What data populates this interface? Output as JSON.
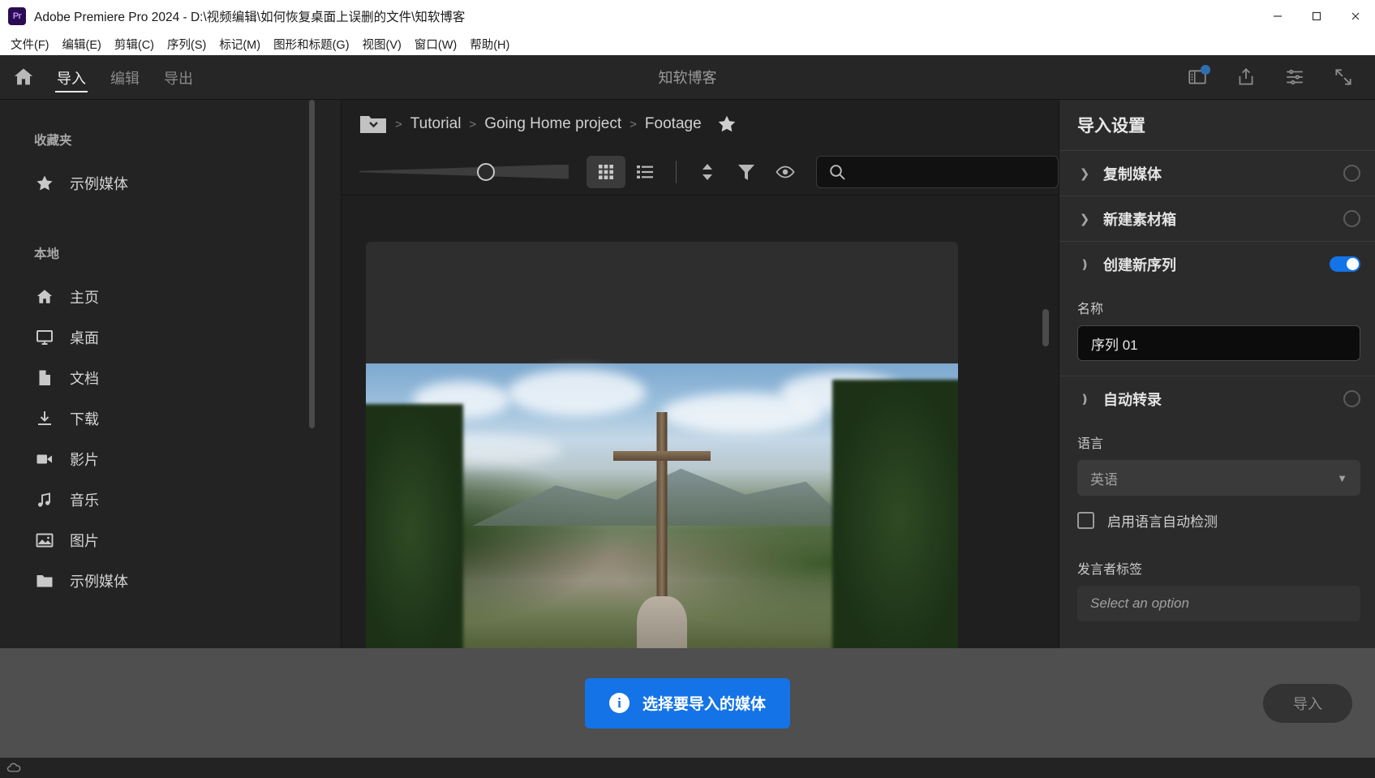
{
  "window": {
    "app_badge": "Pr",
    "title": "Adobe Premiere Pro 2024 - D:\\视频编辑\\如何恢复桌面上误删的文件\\知软博客",
    "minimize_icon": "minimize-icon",
    "maximize_icon": "maximize-icon",
    "close_icon": "close-icon"
  },
  "menubar": {
    "items": [
      {
        "label": "文件(F)"
      },
      {
        "label": "编辑(E)"
      },
      {
        "label": "剪辑(C)"
      },
      {
        "label": "序列(S)"
      },
      {
        "label": "标记(M)"
      },
      {
        "label": "图形和标题(G)"
      },
      {
        "label": "视图(V)"
      },
      {
        "label": "窗口(W)"
      },
      {
        "label": "帮助(H)"
      }
    ]
  },
  "navbar": {
    "home_icon": "home-icon",
    "tabs": [
      {
        "label": "导入",
        "active": true
      },
      {
        "label": "编辑",
        "active": false
      },
      {
        "label": "导出",
        "active": false
      }
    ],
    "center_title": "知软博客",
    "right_icons": [
      {
        "name": "workspace-notification-icon"
      },
      {
        "name": "share-icon"
      },
      {
        "name": "settings-lines-icon"
      },
      {
        "name": "fullscreen-icon"
      }
    ],
    "badge_color": "#2f6fb0"
  },
  "sidebar": {
    "favorites_heading": "收藏夹",
    "favorites": [
      {
        "label": "示例媒体",
        "icon": "star-icon"
      }
    ],
    "local_heading": "本地",
    "local": [
      {
        "label": "主页",
        "icon": "home-icon"
      },
      {
        "label": "桌面",
        "icon": "monitor-icon"
      },
      {
        "label": "文档",
        "icon": "document-icon"
      },
      {
        "label": "下载",
        "icon": "download-icon"
      },
      {
        "label": "影片",
        "icon": "video-camera-icon"
      },
      {
        "label": "音乐",
        "icon": "music-note-icon"
      },
      {
        "label": "图片",
        "icon": "image-icon"
      },
      {
        "label": "示例媒体",
        "icon": "folder-icon"
      }
    ]
  },
  "browser": {
    "breadcrumb": {
      "folder_icon": "folder-dropdown-icon",
      "items": [
        "Tutorial",
        "Going Home project",
        "Footage"
      ],
      "separator": ">",
      "favorite_icon": "star-icon"
    },
    "toolbar": {
      "zoom_slider_value": 56,
      "grid_view_icon": "grid-view-icon",
      "list_view_icon": "list-view-icon",
      "sort_icon": "sort-arrows-icon",
      "filter_icon": "filter-funnel-icon",
      "preview_icon": "eye-icon",
      "search_icon": "search-icon",
      "search_value": "",
      "search_placeholder": ""
    }
  },
  "import_settings": {
    "title": "导入设置",
    "sections": [
      {
        "label": "复制媒体",
        "expanded": false,
        "control": "knob"
      },
      {
        "label": "新建素材箱",
        "expanded": false,
        "control": "knob"
      },
      {
        "label": "创建新序列",
        "expanded": true,
        "control": "toggle",
        "toggle_on": true
      },
      {
        "label": "自动转录",
        "expanded": true,
        "control": "knob"
      }
    ],
    "sequence": {
      "name_label": "名称",
      "name_value": "序列 01"
    },
    "transcription": {
      "language_label": "语言",
      "language_value": "英语",
      "auto_detect_label": "启用语言自动检测",
      "auto_detect_checked": false,
      "speaker_label": "发言者标签",
      "speaker_placeholder": "Select an option"
    },
    "accent_color": "#1473e6"
  },
  "footer": {
    "media_button_label": "选择要导入的媒体",
    "media_button_icon": "info-icon",
    "media_button_color": "#1473e6",
    "import_button_label": "导入",
    "status_icon": "creative-cloud-icon"
  }
}
